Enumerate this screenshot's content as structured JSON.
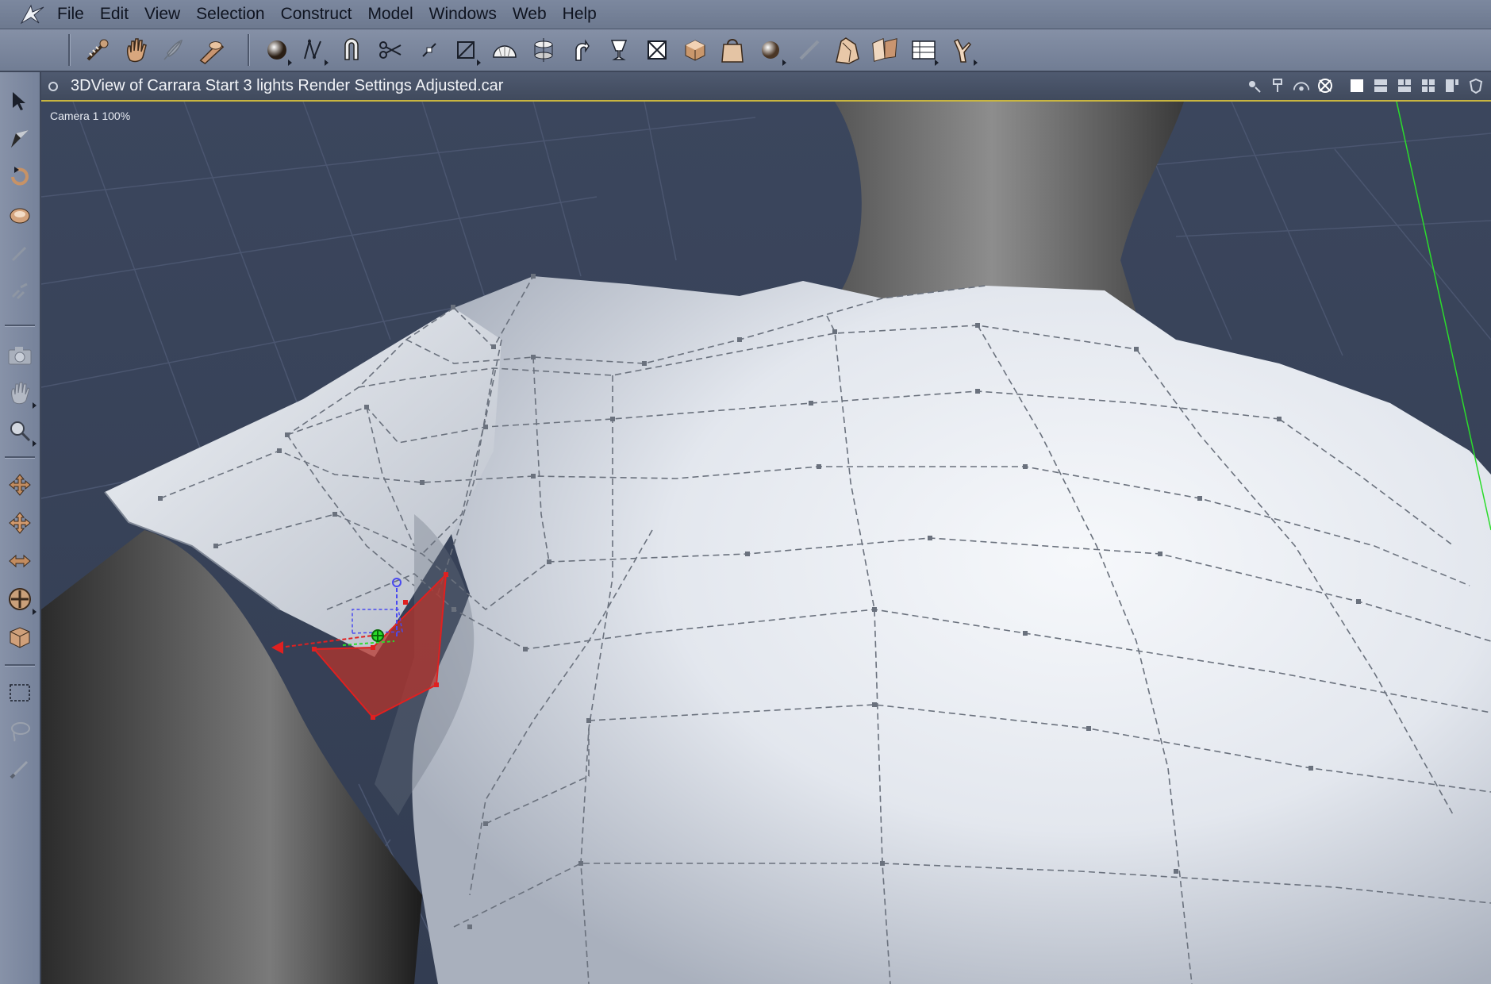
{
  "menu": [
    "File",
    "Edit",
    "View",
    "Selection",
    "Construct",
    "Model",
    "Windows",
    "Web",
    "Help"
  ],
  "toolbar_icons": [
    "brush-icon",
    "hand-icon",
    "feather-icon",
    "wand-icon",
    "sphere-icon",
    "spline-icon",
    "magnet-icon",
    "scissors-icon",
    "sharpen-icon",
    "frame-icon",
    "dome-icon",
    "lathe-icon",
    "arrow-bend-icon",
    "cup-icon",
    "crossbox-icon",
    "cube-icon",
    "bag-icon",
    "sphere-sub-icon",
    "pen-icon",
    "figure-icon",
    "shapes-icon",
    "timeline-icon",
    "pose-icon"
  ],
  "left_tools": [
    "select-arrow-icon",
    "move-arrow-icon",
    "rotate-icon",
    "twist-icon",
    "pick-icon",
    "link-icon",
    "camera-icon",
    "pan-hand-icon",
    "zoom-icon",
    "move-xy-icon",
    "move-xz-icon",
    "move-yz-icon",
    "trackball-icon",
    "material-icon",
    "rect-select-icon",
    "lasso-icon",
    "brush-select-icon"
  ],
  "viewport": {
    "title": "3DView of Carrara Start 3 lights Render Settings Adjusted.car",
    "camera_label": "Camera 1 100%"
  },
  "colors": {
    "selection": "#b8332a",
    "axis_green": "#2bdc2b",
    "title_accent": "#c9b640"
  }
}
